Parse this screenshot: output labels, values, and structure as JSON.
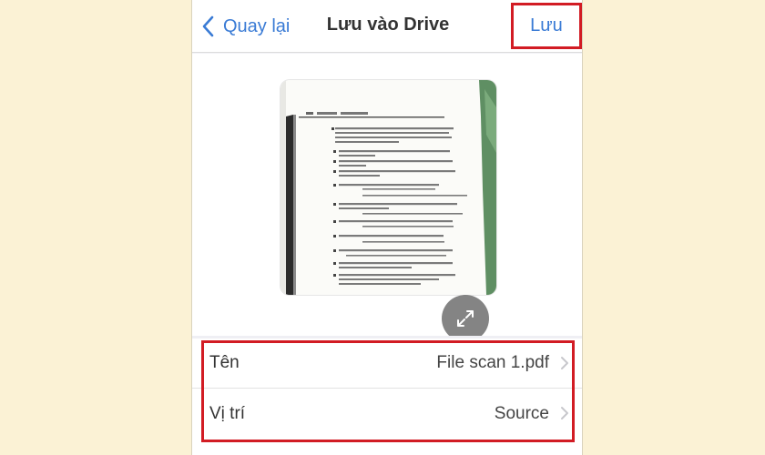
{
  "nav": {
    "back_label": "Quay lại",
    "title": "Lưu vào Drive",
    "save_label": "Lưu"
  },
  "form": {
    "name_label": "Tên",
    "name_value": "File scan 1.pdf",
    "location_label": "Vị trí",
    "location_value": "Source"
  },
  "colors": {
    "accent": "#3a7bd5",
    "highlight": "#d21c24",
    "page_background": "#fbf2d5"
  },
  "icons": {
    "back": "chevron-left-icon",
    "expand": "expand-arrows-icon",
    "disclosure": "chevron-right-icon"
  }
}
